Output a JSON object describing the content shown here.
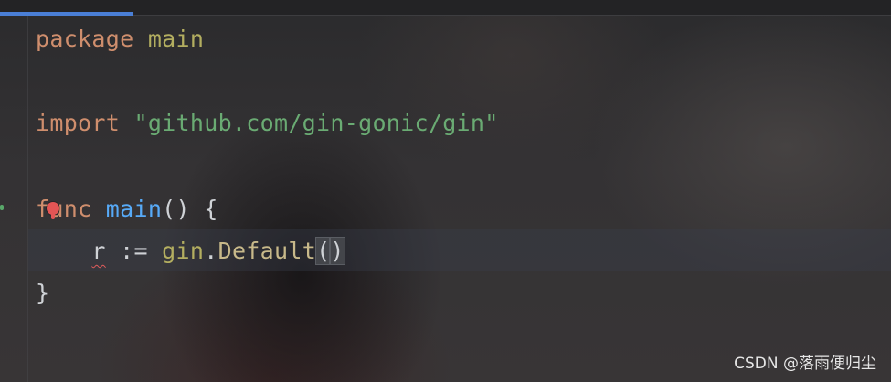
{
  "editor": {
    "lines": {
      "line1": {
        "keyword": "package",
        "name": "main"
      },
      "line3": {
        "keyword": "import",
        "path": "\"github.com/gin-gonic/gin\""
      },
      "line5": {
        "keyword": "func",
        "name": "main",
        "rest": "() {"
      },
      "line6": {
        "indent": "    ",
        "var": "r",
        "op": " := ",
        "pkg": "gin",
        "dot": ".",
        "method": "Default",
        "open_paren": "(",
        "close_paren": ")"
      },
      "line7": {
        "brace": "}"
      }
    },
    "colors": {
      "keyword": "#cf8e6d",
      "function": "#57aaf7",
      "string": "#6aab73",
      "package": "#b3ae60",
      "tab_indicator": "#4a7fd6",
      "breakpoint": "#e35555"
    },
    "icons": [
      "breakpoint-icon",
      "fold-marker-icon"
    ]
  },
  "watermark": {
    "text": "CSDN @落雨便归尘"
  }
}
